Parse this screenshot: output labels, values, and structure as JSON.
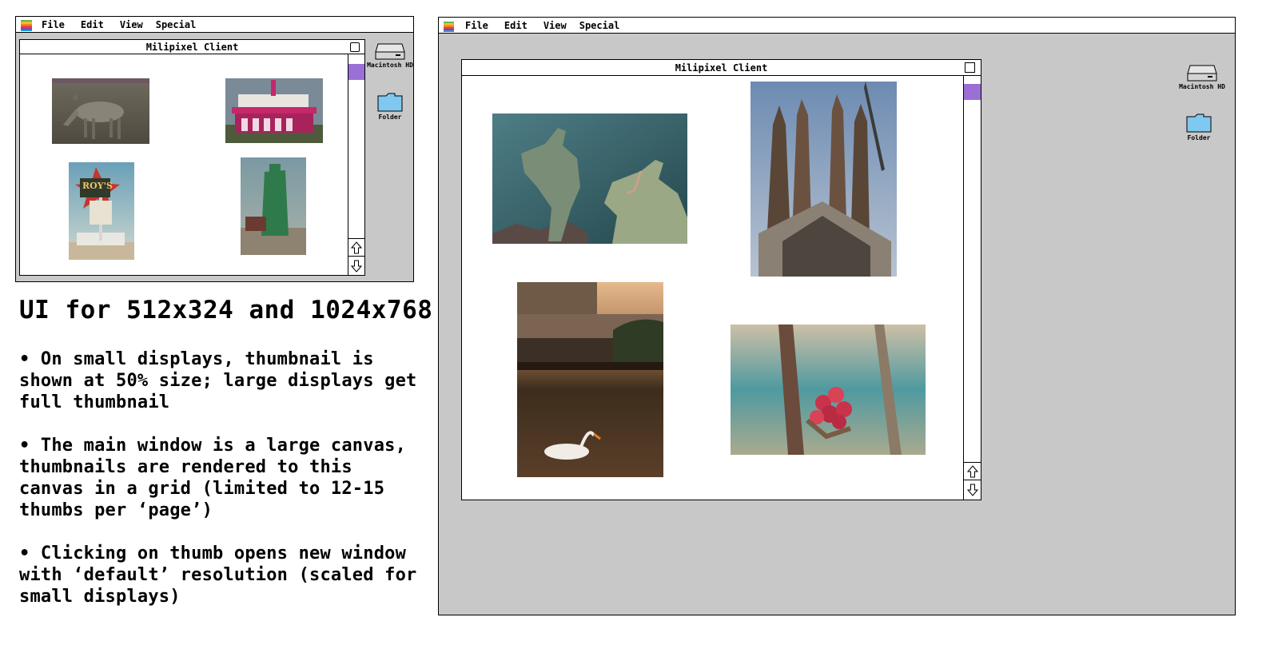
{
  "menu": {
    "apple": "apple-logo-icon",
    "items": [
      "File",
      "Edit",
      "View",
      "Special"
    ]
  },
  "window": {
    "title": "Milipixel Client"
  },
  "desktop_icons": {
    "hd_label": "Macintosh HD",
    "folder_label": "Folder"
  },
  "small_thumbs": [
    {
      "name": "donkey"
    },
    {
      "name": "theater"
    },
    {
      "name": "roys-motel-cafe-sign",
      "sign_text": "ROY'S"
    },
    {
      "name": "green-moai-statue"
    }
  ],
  "large_thumbs": [
    {
      "name": "parasaurolophus-statues"
    },
    {
      "name": "sagrada-familia"
    },
    {
      "name": "swan-on-lake"
    },
    {
      "name": "red-cactus-flower"
    }
  ],
  "notes": {
    "heading": "UI for 512x324 and 1024x768",
    "bullets": [
      "• On small displays, thumbnail is shown at 50% size; large displays get full thumbnail",
      "• The main window is a large canvas, thumbnails are rendered to this canvas in a grid (limited to 12-15 thumbs per ‘page’)",
      "• Clicking on thumb opens new window with ‘default’ resolution (scaled for small displays)"
    ]
  },
  "colors": {
    "desktop": "#c8c8c8",
    "scroll_knob": "#9a6fd6",
    "folder": "#7fc8f0"
  }
}
